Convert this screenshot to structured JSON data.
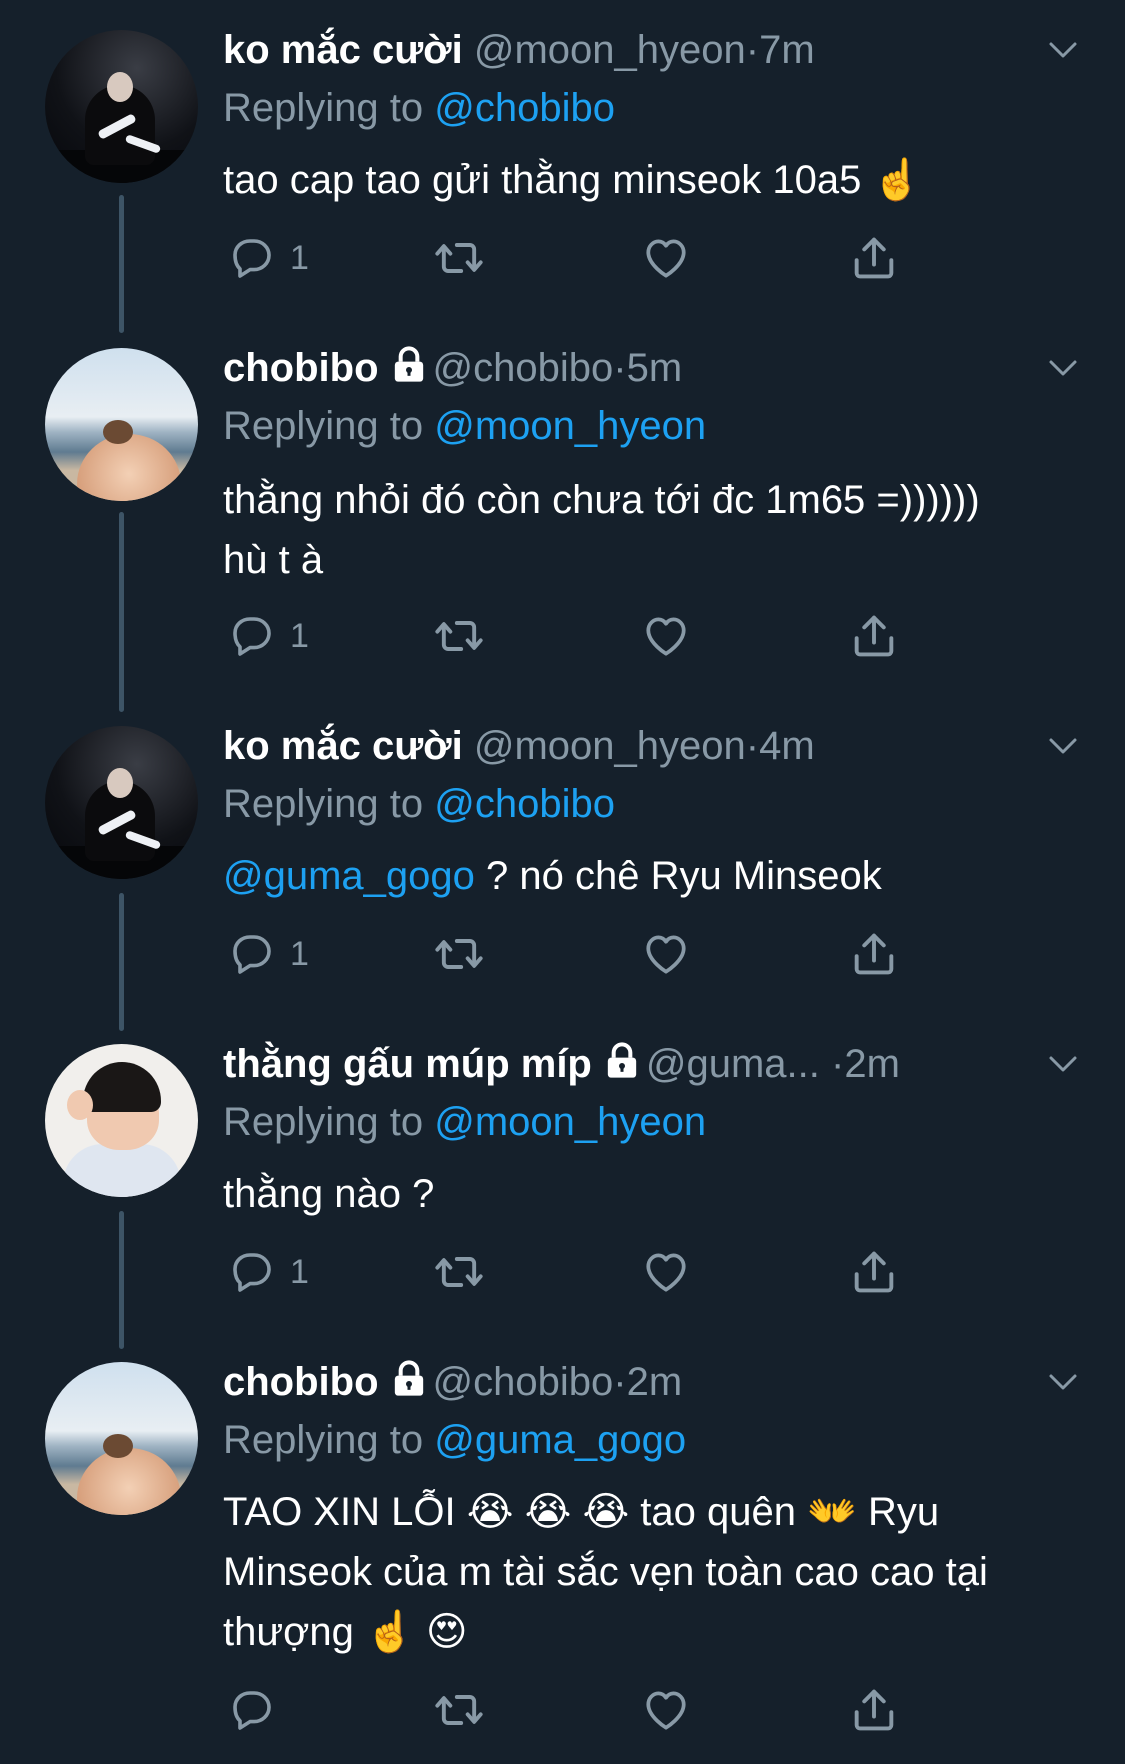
{
  "tweets": [
    {
      "name": "ko mắc cười",
      "handle": "@moon_hyeon",
      "time": "7m",
      "locked": false,
      "reply_prefix": "Replying to",
      "reply_to": "@chobibo",
      "body_text": "tao cap tao gửi thằng minseok 10a5 ☝️",
      "reply_count": "1",
      "avatar_icon": "moon-hyeon-avatar"
    },
    {
      "name": "chobibo",
      "handle": "@chobibo",
      "time": "5m",
      "locked": true,
      "reply_prefix": "Replying to",
      "reply_to": "@moon_hyeon",
      "body_text": "thằng nhỏi đó còn chưa tới đc 1m65 =)))))) hù t à",
      "reply_count": "1",
      "avatar_icon": "chobibo-avatar"
    },
    {
      "name": "ko mắc cười",
      "handle": "@moon_hyeon",
      "time": "4m",
      "locked": false,
      "reply_prefix": "Replying to",
      "reply_to": "@chobibo",
      "body_mention": "@guma_gogo",
      "body_text": " ? nó chê Ryu Minseok",
      "reply_count": "1",
      "avatar_icon": "moon-hyeon-avatar"
    },
    {
      "name": "thằng gấu múp míp",
      "handle": "@guma...",
      "time": "2m",
      "locked": true,
      "reply_prefix": "Replying to",
      "reply_to": "@moon_hyeon",
      "body_text": "thằng nào ?",
      "reply_count": "1",
      "avatar_icon": "guma-gogo-avatar"
    },
    {
      "name": "chobibo",
      "handle": "@chobibo",
      "time": "2m",
      "locked": true,
      "reply_prefix": "Replying to",
      "reply_to": "@guma_gogo",
      "body_text": "TAO XIN LỖI 😭 😭 😭 tao quên 👐 Ryu Minseok của m tài sắc vẹn toàn cao cao tại thượng ☝️ 😍",
      "reply_count": "",
      "avatar_icon": "chobibo-avatar"
    }
  ],
  "colors": {
    "background": "#15202b",
    "muted": "#8899a6",
    "link": "#1da1f2",
    "thread_line": "#3d5466"
  },
  "icons": [
    "reply-icon",
    "retweet-icon",
    "like-icon",
    "share-icon",
    "chevron-down-icon",
    "lock-icon"
  ]
}
